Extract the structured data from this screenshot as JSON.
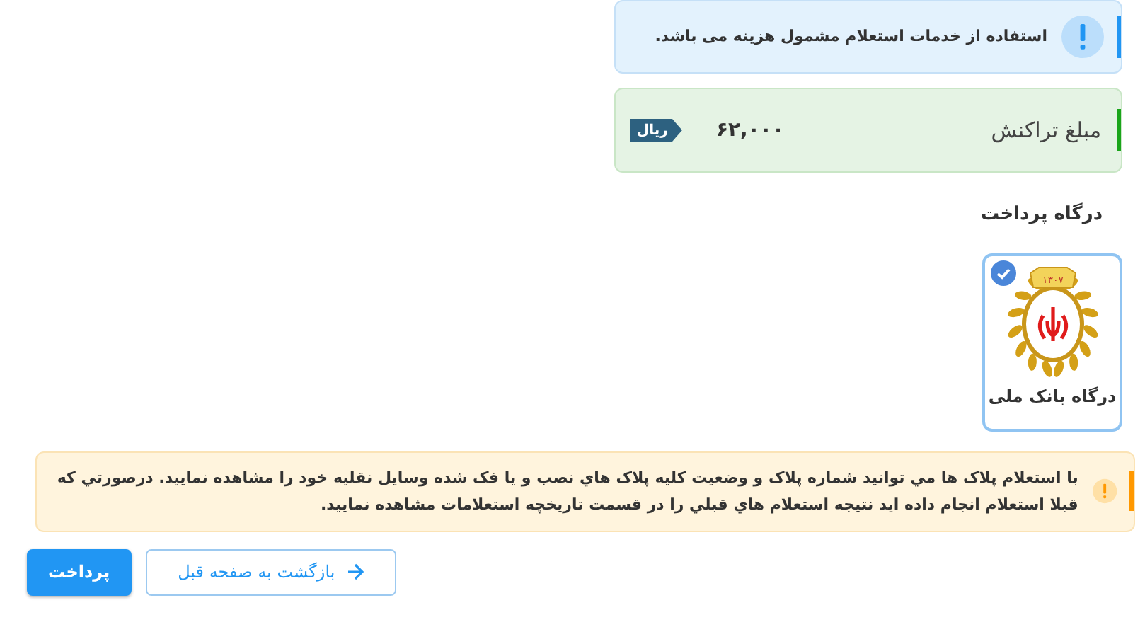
{
  "info_alert": {
    "text": "استفاده از خدمات استعلام مشمول هزینه می باشد."
  },
  "amount": {
    "label": "مبلغ تراکنش",
    "value": "۶۲,۰۰۰",
    "currency": "ریال"
  },
  "gateway_section": {
    "title": "درگاه پرداخت",
    "gateways": [
      {
        "label": "درگاه بانک ملی",
        "logo_year": "۱۳۰۷",
        "selected": true
      }
    ]
  },
  "warning_alert": {
    "text": "با استعلام پلاک ها مي توانيد شماره پلاک و وضعيت کليه پلاک هاي نصب و يا فک شده وسايل نقليه خود را مشاهده نماييد. درصورتي که قبلا استعلام انجام داده ايد نتيجه استعلام هاي قبلي را در قسمت تاريخچه استعلامات مشاهده نماييد."
  },
  "buttons": [
    {
      "kind": "back",
      "label": "بازگشت به صفحه قبل"
    },
    {
      "kind": "primary",
      "label": "پرداخت"
    }
  ]
}
